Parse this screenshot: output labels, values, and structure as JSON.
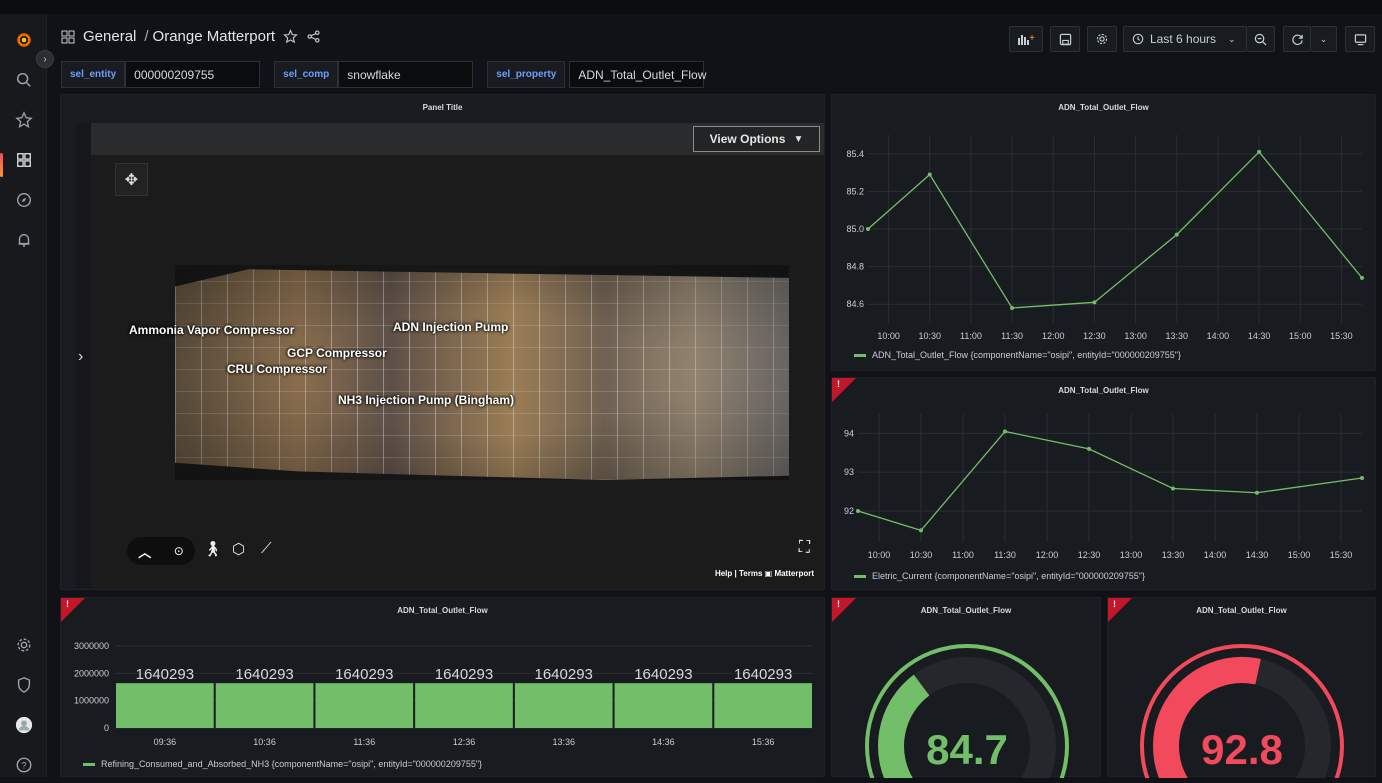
{
  "header": {
    "breadcrumb_folder": "General",
    "breadcrumb_sep": "/",
    "dashboard_title": "Orange Matterport",
    "time_range": "Last 6 hours"
  },
  "variables": [
    {
      "label": "sel_entity",
      "value": "000000209755"
    },
    {
      "label": "sel_comp",
      "value": "snowflake"
    },
    {
      "label": "sel_property",
      "value": "ADN_Total_Outlet_Flow"
    }
  ],
  "matterport": {
    "panel_title": "Panel Title",
    "view_options": "View Options",
    "help": "Help",
    "terms": "Terms",
    "brand": "Matterport",
    "labels": [
      "Ammonia Vapor Compressor",
      "ADN Injection Pump",
      "GCP Compressor",
      "CRU Compressor",
      "NH3 Injection Pump (Bingham)"
    ]
  },
  "panels": {
    "flow_line": {
      "title": "ADN_Total_Outlet_Flow",
      "legend": "ADN_Total_Outlet_Flow {componentName=\"osipi\", entityId=\"000000209755\"}"
    },
    "current_line": {
      "title": "ADN_Total_Outlet_Flow",
      "legend": "Eletric_Current {componentName=\"osipi\", entityId=\"000000209755\"}",
      "alert": "!"
    },
    "bar": {
      "title": "ADN_Total_Outlet_Flow",
      "legend": "Refining_Consumed_and_Absorbed_NH3 {componentName=\"osipi\", entityId=\"000000209755\"}",
      "alert": "!"
    },
    "gauge1": {
      "title": "ADN_Total_Outlet_Flow",
      "value": "84.7",
      "alert": "!"
    },
    "gauge2": {
      "title": "ADN_Total_Outlet_Flow",
      "value": "92.8",
      "alert": "!"
    }
  },
  "chart_data": [
    {
      "type": "line",
      "series": [
        {
          "name": "ADN_Total_Outlet_Flow {componentName=\"osipi\", entityId=\"000000209755\"}",
          "x": [
            "09:45",
            "10:30",
            "11:30",
            "12:30",
            "13:30",
            "14:30",
            "15:45"
          ],
          "y": [
            85.0,
            85.29,
            84.58,
            84.61,
            84.97,
            85.41,
            84.74
          ]
        }
      ],
      "x_ticks": [
        "10:00",
        "10:30",
        "11:00",
        "11:30",
        "12:00",
        "12:30",
        "13:00",
        "13:30",
        "14:00",
        "14:30",
        "15:00",
        "15:30"
      ],
      "y_ticks": [
        "84.6",
        "84.8",
        "85.0",
        "85.2",
        "85.4"
      ],
      "ylim": [
        84.5,
        85.5
      ],
      "color": "#73bf69"
    },
    {
      "type": "line",
      "series": [
        {
          "name": "Eletric_Current {componentName=\"osipi\", entityId=\"000000209755\"}",
          "x": [
            "09:45",
            "10:30",
            "11:30",
            "12:30",
            "13:30",
            "14:30",
            "15:45"
          ],
          "y": [
            92.0,
            91.5,
            94.05,
            93.6,
            92.58,
            92.47,
            92.85
          ]
        }
      ],
      "x_ticks": [
        "10:00",
        "10:30",
        "11:00",
        "11:30",
        "12:00",
        "12:30",
        "13:00",
        "13:30",
        "14:00",
        "14:30",
        "15:00",
        "15:30"
      ],
      "y_ticks": [
        "92",
        "93",
        "94"
      ],
      "ylim": [
        91.2,
        94.5
      ],
      "color": "#73bf69"
    },
    {
      "type": "bar",
      "categories": [
        "09:36",
        "10:36",
        "11:36",
        "12:36",
        "13:36",
        "14:36",
        "15:36"
      ],
      "values": [
        1640293,
        1640293,
        1640293,
        1640293,
        1640293,
        1640293,
        1640293
      ],
      "y_ticks": [
        "0",
        "1000000",
        "2000000",
        "3000000"
      ],
      "ylim": [
        0,
        3000000
      ],
      "color": "#73bf69"
    },
    {
      "type": "gauge",
      "value": 84.7,
      "fraction": 0.35,
      "color": "#73bf69"
    },
    {
      "type": "gauge",
      "value": 92.8,
      "fraction": 0.55,
      "color": "#f2495c"
    }
  ]
}
